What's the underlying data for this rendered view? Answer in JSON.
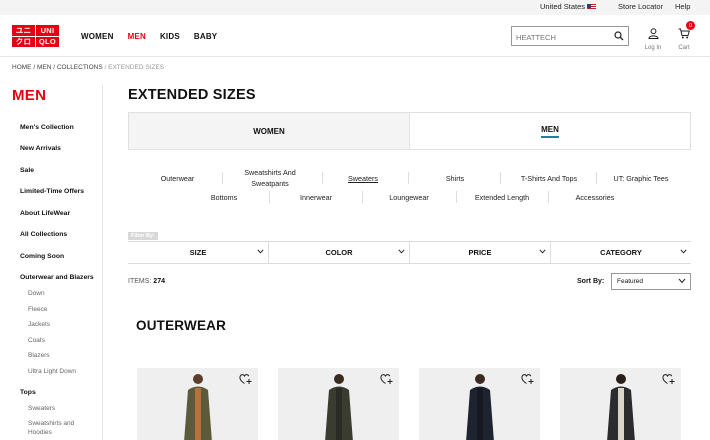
{
  "topbar": {
    "country": "United States",
    "store_locator": "Store Locator",
    "help": "Help"
  },
  "header": {
    "logo": [
      "ユニ",
      "UNI",
      "クロ",
      "QLO"
    ],
    "nav": [
      {
        "label": "WOMEN",
        "active": false
      },
      {
        "label": "MEN",
        "active": true
      },
      {
        "label": "KIDS",
        "active": false
      },
      {
        "label": "BABY",
        "active": false
      }
    ],
    "search_placeholder": "HEATTECH",
    "login_label": "Log In",
    "cart_label": "Cart",
    "cart_count": "0"
  },
  "breadcrumb": {
    "home": "HOME",
    "men": "MEN",
    "collections": "COLLECTIONS",
    "current": "EXTENDED SIZES",
    "sep": "/"
  },
  "sidebar": {
    "title": "MEN",
    "items": [
      "Men's Collection",
      "New Arrivals",
      "Sale",
      "Limited-Time Offers",
      "About LifeWear",
      "All Collections",
      "Coming Soon",
      "Outerwear and Blazers"
    ],
    "outerwear_sub": [
      "Down",
      "Fleece",
      "Jackets",
      "Coats",
      "Blazers",
      "Ultra Light Down"
    ],
    "tops": "Tops",
    "tops_sub": [
      "Sweaters",
      "Sweatshirts and",
      "Hoodies"
    ]
  },
  "main": {
    "title": "EXTENDED SIZES",
    "gender_tabs": {
      "women": "WOMEN",
      "men": "MEN"
    },
    "categories_row1": [
      "Outerwear",
      "Sweatshirts And",
      "Sweatpants",
      "Sweaters",
      "Shirts",
      "T-Shirts And Tops",
      "UT: Graphic Tees"
    ],
    "categories_row2": [
      "Bottoms",
      "Innerwear",
      "Loungewear",
      "Extended Length",
      "Accessories"
    ],
    "selected_category": "Sweaters",
    "filter_by": "Filter By:",
    "filters": [
      "SIZE",
      "COLOR",
      "PRICE",
      "CATEGORY"
    ],
    "items_label": "ITEMS:",
    "items_count": "274",
    "sort_label": "Sort By:",
    "sort_value": "Featured",
    "section_title": "OUTERWEAR"
  },
  "products": [
    {
      "name": "product-parka-khaki",
      "coat_color": "#5b5a3a",
      "inner_color": "#b5733b"
    },
    {
      "name": "product-long-down-olive",
      "coat_color": "#3a3c30",
      "inner_color": "#2b2b25"
    },
    {
      "name": "product-long-down-navy",
      "coat_color": "#1e2330",
      "inner_color": "#151821"
    },
    {
      "name": "product-puffer-black",
      "coat_color": "#2a2c2e",
      "inner_color": "#d9d6c8"
    }
  ],
  "colors": {
    "brand_red": "#e60012",
    "tab_underline": "#1b7fa6"
  }
}
